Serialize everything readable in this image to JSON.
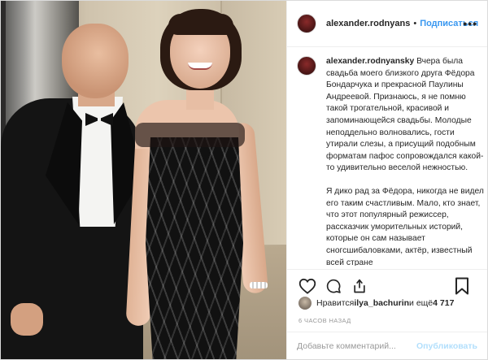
{
  "post": {
    "username": "alexander.rodnyans",
    "separator": "•",
    "follow_label": "Подписаться",
    "more_label": "•••"
  },
  "caption": {
    "username": "alexander.rodnyansky",
    "paragraph_1": "Вчера была свадьба моего близкого друга Фёдора Бондарчука и прекрасной Паулины Андреевой. Признаюсь, я не помню такой трогательной, красивой и запоминающейся свадьбы. Молодые неподдельно волновались, гости утирали слезы, а присущий подобным форматам пафос сопровождался какой-то удивительно веселой нежностью.",
    "paragraph_2": "Я дико рад за Фёдора, никогда не видел его таким счастливым. Мало, кто знает, что этот популярный режиссер, рассказчик умоpительных историй, которые он сам называет сногсшибаловками, актёр, известный всей стране"
  },
  "likes": {
    "prefix": "Нравится ",
    "liker": "ilya_bachurin",
    "middle": " и ещё ",
    "count": "4 717"
  },
  "timestamp": "6 часов назад",
  "comment": {
    "placeholder": "Добавьте комментарий...",
    "publish_label": "Опубликовать"
  },
  "icons": {
    "like": "heart-icon",
    "comment": "comment-bubble-icon",
    "share": "share-icon",
    "save": "bookmark-icon"
  }
}
